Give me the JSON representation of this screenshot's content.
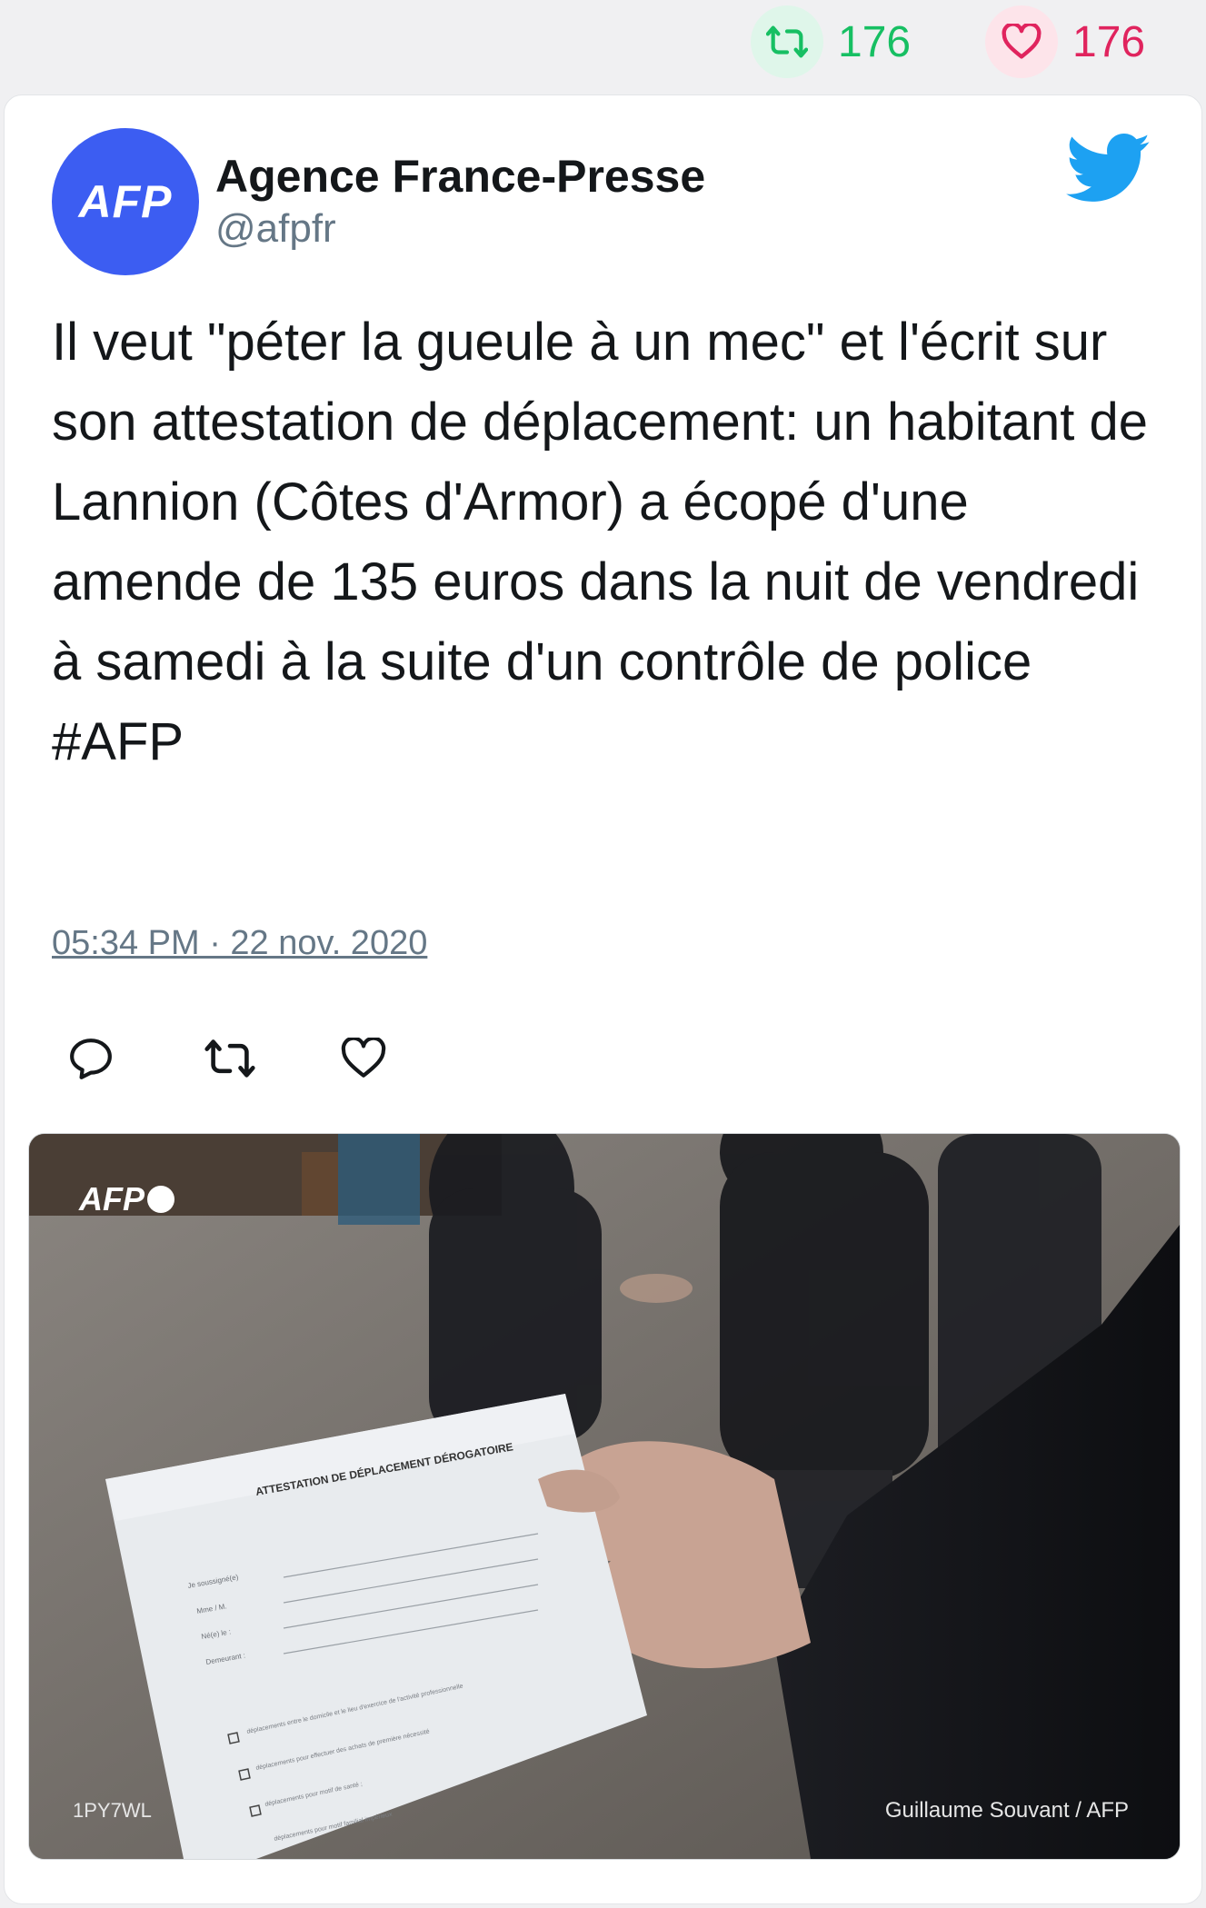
{
  "stats": {
    "retweets": "176",
    "likes": "176"
  },
  "tweet": {
    "author_name": "Agence France-Presse",
    "author_handle": "@afpfr",
    "avatar_text": "AFP",
    "text": "Il veut \"péter la gueule à un mec\" et l'écrit sur son attestation de déplacement: un habitant de Lannion (Côtes d'Armor) a écopé d'une amende de 135 euros dans la nuit de vendredi à samedi à la suite d'un contrôle de police #AFP",
    "timestamp": "05:34 PM · 22 nov. 2020"
  },
  "photo": {
    "watermark": "AFP",
    "photo_id": "1PY7WL",
    "credit": "Guillaume Souvant / AFP",
    "document_title": "ATTESTATION DE DÉPLACEMENT DÉROGATOIRE",
    "form_fields": [
      "Je soussigné(e)",
      "Mme / M.",
      "Né(e) le :",
      "Demeurant :"
    ],
    "checkbox_lines": [
      "déplacements entre le domicile et le lieu d'exercice de l'activité professionnelle",
      "déplacements pour effectuer des achats de première nécessité",
      "déplacements pour motif de santé ;",
      "déplacements pour motif familial impérieux"
    ]
  },
  "icons": {
    "retweet": "retweet-icon",
    "like": "heart-icon",
    "reply": "reply-icon",
    "brand": "twitter-bird-icon"
  },
  "colors": {
    "retweet_green": "#17bf63",
    "like_red": "#e0245e",
    "twitter_blue": "#1da1f2",
    "avatar_blue": "#3c5df2",
    "muted": "#657786"
  }
}
